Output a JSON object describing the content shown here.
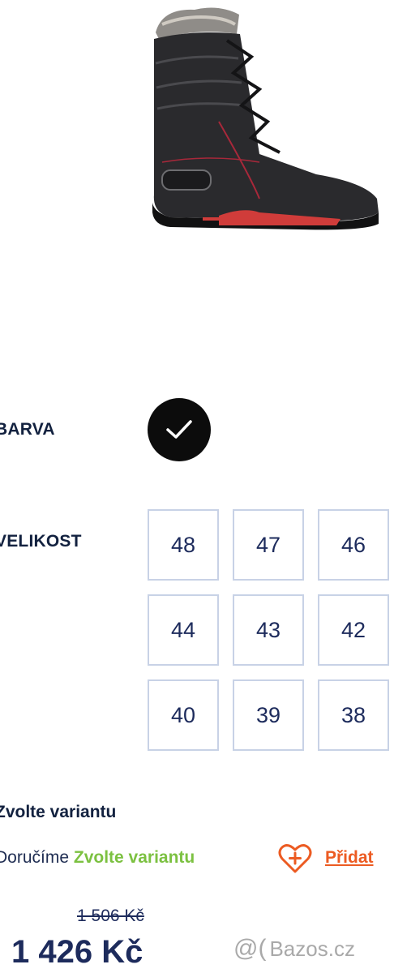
{
  "product": {
    "image_icon": "winter-boot-image"
  },
  "color_section": {
    "label": "BARVA",
    "selected_icon": "check-icon",
    "swatch_color": "#0c0c0c"
  },
  "size_section": {
    "label": "VELIKOST",
    "sizes": [
      "48",
      "47",
      "46",
      "44",
      "43",
      "42",
      "40",
      "39",
      "38"
    ]
  },
  "variant": {
    "title": "Zvolte variantu"
  },
  "delivery": {
    "prefix": "Doručíme",
    "value": "Zvolte variantu"
  },
  "actions": {
    "wishlist_icon": "heart-plus-icon",
    "add_label": "Přidat",
    "accent_color": "#ec5b22"
  },
  "pricing": {
    "old_price": "1 506 Kč",
    "price": "1 426 Kč"
  },
  "watermark": {
    "symbol": "@(",
    "text": "Bazos.cz"
  }
}
